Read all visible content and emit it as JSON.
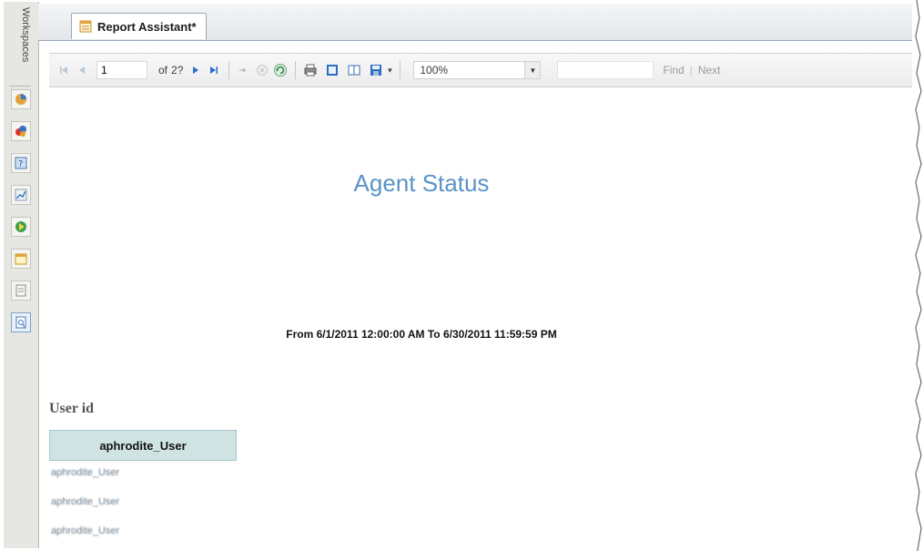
{
  "workspaces": {
    "label": "Workspaces",
    "icons": [
      "chart-pie-icon",
      "user-group-icon",
      "help-book-icon",
      "trend-chart-icon",
      "play-green-icon",
      "calendar-icon",
      "document-icon",
      "report-icon"
    ]
  },
  "tab": {
    "title": "Report Assistant*",
    "icon": "report-tab-icon"
  },
  "toolbar": {
    "page_value": "1",
    "of_label": "of",
    "total_pages": "2?",
    "zoom_value": "100%",
    "find_label": "Find",
    "find_separator": "|",
    "next_label": "Next"
  },
  "report": {
    "title": "Agent Status",
    "date_range": "From 6/1/2011 12:00:00 AM  To 6/30/2011 11:59:59 PM",
    "group_label": "User id",
    "column_header": "aphrodite_User",
    "rows": [
      "aphrodite_User",
      "aphrodite_User",
      "aphrodite_User"
    ]
  },
  "colors": {
    "title": "#5b93c7",
    "header_fill": "#cfe3e3",
    "accent_blue": "#2a6fc9"
  }
}
